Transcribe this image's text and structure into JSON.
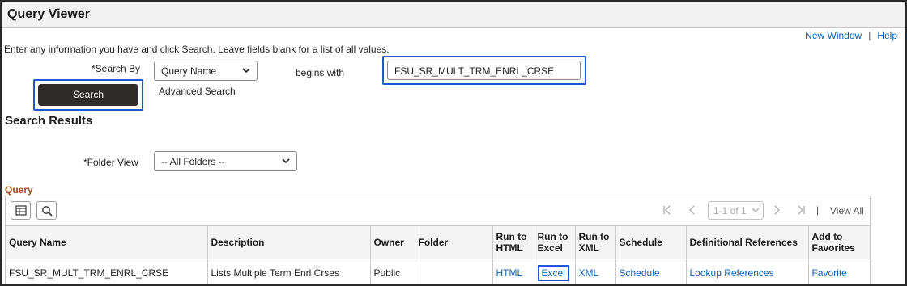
{
  "window": {
    "title": "Query Viewer"
  },
  "toplinks": {
    "new_window": "New Window",
    "separator": "|",
    "help": "Help"
  },
  "instructions": "Enter any information you have and click Search. Leave fields blank for a list of all values.",
  "search": {
    "search_by_label": "*Search By",
    "search_by_value": "Query Name",
    "operator_label": "begins with",
    "query_value": "FSU_SR_MULT_TRM_ENRL_CRSE",
    "search_button": "Search",
    "advanced_link": "Advanced Search"
  },
  "results": {
    "heading": "Search Results",
    "folder_label": "*Folder View",
    "folder_value": "-- All Folders --"
  },
  "grid": {
    "title": "Query",
    "pager_range": "1-1 of 1",
    "view_all": "View All",
    "pager_separator": "|",
    "columns": {
      "query_name": "Query Name",
      "description": "Description",
      "owner": "Owner",
      "folder": "Folder",
      "run_html": [
        "Run to",
        "HTML"
      ],
      "run_excel": [
        "Run to",
        "Excel"
      ],
      "run_xml": [
        "Run to",
        "XML"
      ],
      "schedule": "Schedule",
      "definitional": "Definitional References",
      "favorites": [
        "Add to",
        "Favorites"
      ]
    },
    "rows": [
      {
        "query_name": "FSU_SR_MULT_TRM_ENRL_CRSE",
        "description": "Lists Multiple Term Enrl Crses",
        "owner": "Public",
        "folder": "",
        "html": "HTML",
        "excel": "Excel",
        "xml": "XML",
        "schedule": "Schedule",
        "lookup": "Lookup References",
        "favorite": "Favorite"
      }
    ]
  },
  "colors": {
    "link": "#0b62b5",
    "highlight": "#1f55d6",
    "grid_title": "#9b4f17",
    "button": "#2e2b28"
  }
}
